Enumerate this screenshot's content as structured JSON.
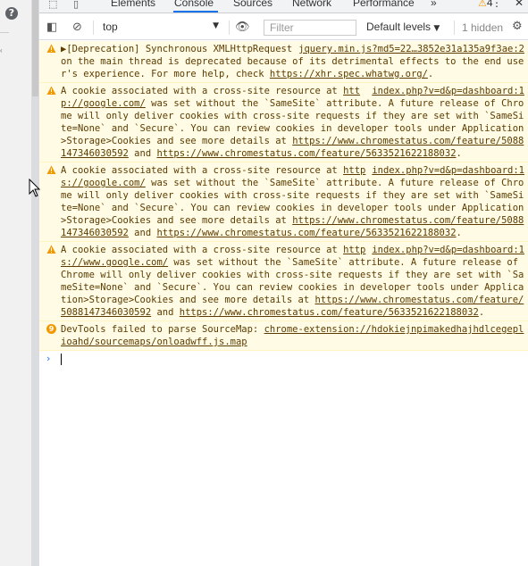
{
  "page": {
    "help_glyph": "?"
  },
  "tabs": [
    {
      "label": "Elements"
    },
    {
      "label": "Console"
    },
    {
      "label": "Sources"
    },
    {
      "label": "Network"
    },
    {
      "label": "Performance"
    }
  ],
  "tabbar": {
    "more": "»",
    "warning_count": "4",
    "menu": "⋮",
    "close": "✕"
  },
  "toolbar": {
    "context": "top",
    "filter_placeholder": "Filter",
    "levels": "Default levels",
    "hidden": "1 hidden"
  },
  "messages": [
    {
      "type": "warning",
      "source": "jquery.min.js?md5=22…3852e31a135a9f3ae:2",
      "parts": [
        {
          "t": "text",
          "v": "▶[Deprecation] Synchronous XMLHttpRequest on the main thread is deprecated because of its detrimental effects to the end user's experience. For more help, check "
        },
        {
          "t": "link",
          "v": "https://xhr.spec.whatwg.org/"
        },
        {
          "t": "text",
          "v": "."
        }
      ]
    },
    {
      "type": "warning",
      "source": "index.php?v=d&p=dashboard:1",
      "parts": [
        {
          "t": "text",
          "v": "A cookie associated with a cross-site resource at "
        },
        {
          "t": "link",
          "v": "http://google.com/"
        },
        {
          "t": "text",
          "v": " was set without the `SameSite` attribute. A future release of Chrome will only deliver cookies with cross-site requests if they are set with `SameSite=None` and `Secure`. You can review cookies in developer tools under Application>Storage>Cookies and see more details at "
        },
        {
          "t": "link",
          "v": "https://www.chromestatus.com/feature/5088147346030592"
        },
        {
          "t": "text",
          "v": " and "
        },
        {
          "t": "link",
          "v": "https://www.chromestatus.com/feature/5633521622188032"
        },
        {
          "t": "text",
          "v": "."
        }
      ]
    },
    {
      "type": "warning",
      "source": "index.php?v=d&p=dashboard:1",
      "parts": [
        {
          "t": "text",
          "v": "A cookie associated with a cross-site resource at "
        },
        {
          "t": "link",
          "v": "https://google.com/"
        },
        {
          "t": "text",
          "v": " was set without the `SameSite` attribute. A future release of Chrome will only deliver cookies with cross-site requests if they are set with `SameSite=None` and `Secure`. You can review cookies in developer tools under Application>Storage>Cookies and see more details at "
        },
        {
          "t": "link",
          "v": "https://www.chromestatus.com/feature/5088147346030592"
        },
        {
          "t": "text",
          "v": " and "
        },
        {
          "t": "link",
          "v": "https://www.chromestatus.com/feature/5633521622188032"
        },
        {
          "t": "text",
          "v": "."
        }
      ]
    },
    {
      "type": "warning",
      "source": "index.php?v=d&p=dashboard:1",
      "parts": [
        {
          "t": "text",
          "v": "A cookie associated with a cross-site resource at "
        },
        {
          "t": "link",
          "v": "https://www.google.com/"
        },
        {
          "t": "text",
          "v": " was set without the `SameSite` attribute. A future release of Chrome will only deliver cookies with cross-site requests if they are set with `SameSite=None` and `Secure`. You can review cookies in developer tools under Application>Storage>Cookies and see more details at "
        },
        {
          "t": "link",
          "v": "https://www.chromestatus.com/feature/5088147346030592"
        },
        {
          "t": "text",
          "v": " and "
        },
        {
          "t": "link",
          "v": "https://www.chromestatus.com/feature/5633521622188032"
        },
        {
          "t": "text",
          "v": "."
        }
      ]
    },
    {
      "type": "info",
      "count": "9",
      "source": "",
      "parts": [
        {
          "t": "text",
          "v": "DevTools failed to parse SourceMap: "
        },
        {
          "t": "link",
          "v": "chrome-extension://hdokiejnpimakedhajhdlcegeplioahd/sourcemaps/onloadwff.js.map"
        }
      ]
    }
  ],
  "colors": {
    "warning_bg": "#fffbe5",
    "warning_text": "#5c3c00",
    "accent": "#1a73e8",
    "warn_icon": "#f29900"
  }
}
